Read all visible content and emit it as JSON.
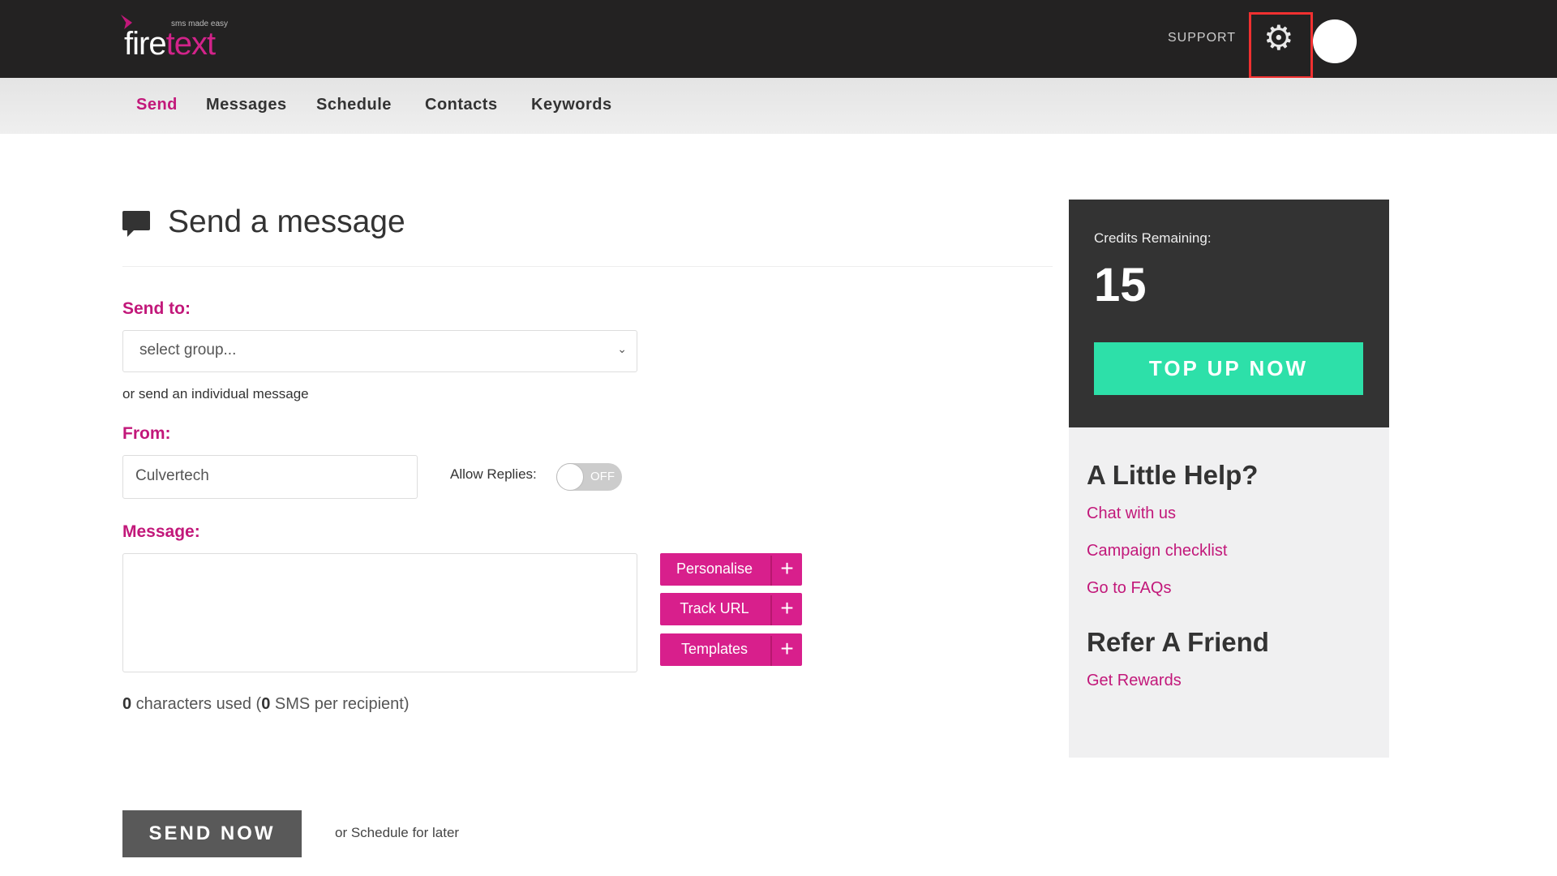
{
  "header": {
    "logo_tagline": "sms made easy",
    "logo_word_1": "fire",
    "logo_word_2": "text",
    "support": "SUPPORT",
    "settings_icon": "gear-icon",
    "avatar": "user-avatar"
  },
  "nav": {
    "items": [
      {
        "label": "Send",
        "active": true
      },
      {
        "label": "Messages"
      },
      {
        "label": "Schedule"
      },
      {
        "label": "Contacts"
      },
      {
        "label": "Keywords"
      }
    ]
  },
  "main": {
    "title": "Send a message",
    "send_to_label": "Send to:",
    "group_select": "select group...",
    "individual_link": "or send an individual message",
    "from_label": "From:",
    "from_value": "Culvertech",
    "allow_replies_label": "Allow Replies:",
    "allow_replies_state": "OFF",
    "message_label": "Message:",
    "message_value": "",
    "buttons": [
      {
        "label": "Personalise"
      },
      {
        "label": "Track URL"
      },
      {
        "label": "Templates"
      }
    ],
    "chars_count": "0",
    "chars_text": " characters used (",
    "sms_count": "0",
    "sms_text": " SMS per recipient)",
    "send_now": "SEND NOW",
    "schedule_link": "or Schedule for later"
  },
  "sidebar": {
    "credits_label": "Credits Remaining:",
    "credits_value": "15",
    "top_up": "TOP UP NOW",
    "help_title": "A Little Help?",
    "help_links": [
      "Chat with us",
      "Campaign checklist",
      "Go to FAQs"
    ],
    "refer_title": "Refer A Friend",
    "refer_link": "Get Rewards"
  },
  "colors": {
    "brand": "#d2238a",
    "accent": "#2de0a9",
    "header": "#232222"
  }
}
